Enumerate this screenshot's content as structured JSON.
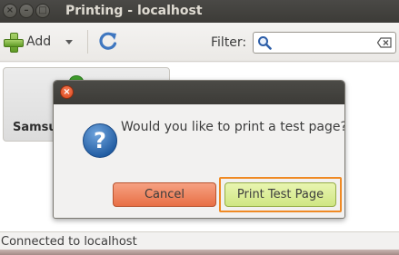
{
  "window": {
    "title": "Printing - localhost"
  },
  "toolbar": {
    "add_label": "Add",
    "filter_label": "Filter:",
    "filter_value": ""
  },
  "printers": [
    {
      "name": "Samsung"
    }
  ],
  "status": {
    "text": "Connected to localhost"
  },
  "dialog": {
    "message": "Would you like to print a test page?",
    "cancel_label": "Cancel",
    "print_label": "Print Test Page"
  },
  "icons": {
    "add": "plus-icon",
    "refresh": "refresh-icon",
    "search": "search-icon",
    "clear": "clear-icon",
    "question": "question-icon"
  },
  "colors": {
    "titlebar": "#3c3b37",
    "cancel_button": "#e86f45",
    "print_button": "#cfe683",
    "focus_ring": "#f08a24",
    "close_button": "#d9461b"
  }
}
